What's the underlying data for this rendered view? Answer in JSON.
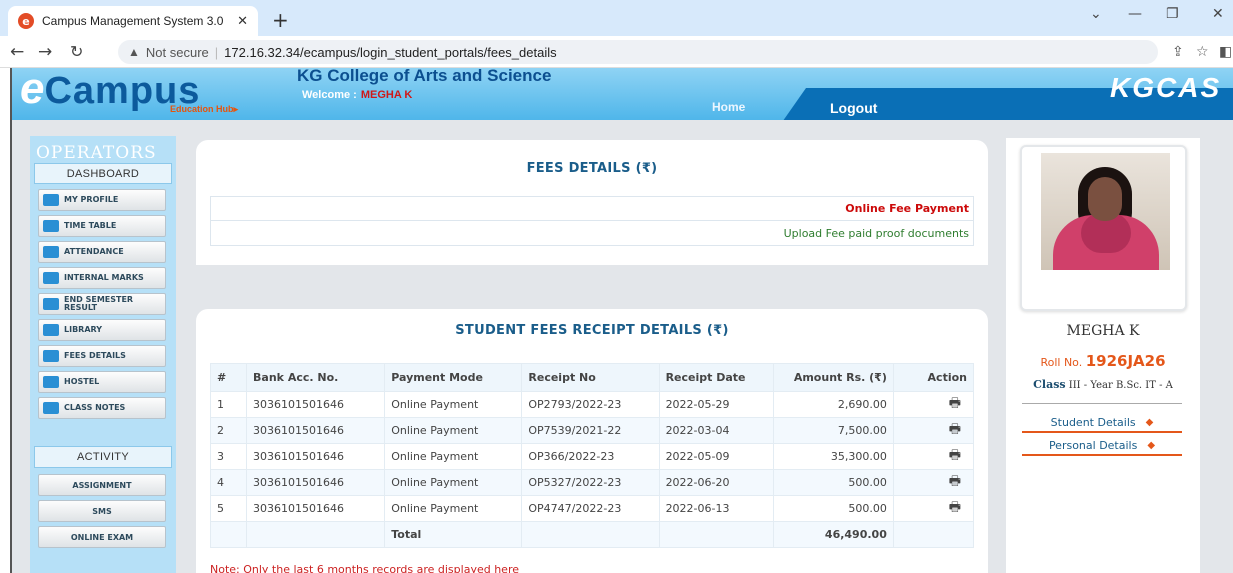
{
  "browser": {
    "tab_title": "Campus Management System 3.0",
    "not_secure": "Not secure",
    "url": "172.16.32.34/ecampus/login_student_portals/fees_details"
  },
  "header": {
    "logo_e": "e",
    "logo_text": "Campus",
    "logo_sub": "Education Hub▸",
    "college": "KG College of Arts and Science",
    "welcome_label": "Welcome :",
    "welcome_name": "MEGHA K",
    "nav_home": "Home",
    "nav_logout": "Logout",
    "brand": "KGCAS"
  },
  "sidebar": {
    "title": "OPERATORS",
    "dashboard": "DASHBOARD",
    "items": [
      {
        "label": "MY PROFILE",
        "icon": "building-icon"
      },
      {
        "label": "TIME TABLE",
        "icon": "clock-icon"
      },
      {
        "label": "ATTENDANCE",
        "icon": "calendar-icon"
      },
      {
        "label": "INTERNAL MARKS",
        "icon": "chart-icon"
      },
      {
        "label": "END SEMESTER RESULT",
        "icon": "trend-icon"
      },
      {
        "label": "LIBRARY",
        "icon": "books-icon"
      },
      {
        "label": "FEES DETAILS",
        "icon": "calendar-icon"
      },
      {
        "label": "HOSTEL",
        "icon": "building-icon"
      },
      {
        "label": "CLASS NOTES",
        "icon": "books-icon"
      }
    ],
    "activity_title": "ACTIVITY",
    "activity_items": [
      "ASSIGNMENT",
      "SMS",
      "ONLINE EXAM"
    ]
  },
  "fees_panel": {
    "title": "FEES DETAILS (₹)",
    "online_fee_payment": "Online Fee Payment",
    "upload_proof": "Upload Fee paid proof documents"
  },
  "receipts": {
    "title": "STUDENT FEES RECEIPT DETAILS (₹)",
    "columns": [
      "#",
      "Bank Acc. No.",
      "Payment Mode",
      "Receipt No",
      "Receipt Date",
      "Amount Rs. (₹)",
      "Action"
    ],
    "rows": [
      {
        "num": "1",
        "bank": "3036101501646",
        "mode": "Online Payment",
        "receipt": "OP2793/2022-23",
        "date": "2022-05-29",
        "amount": "2,690.00"
      },
      {
        "num": "2",
        "bank": "3036101501646",
        "mode": "Online Payment",
        "receipt": "OP7539/2021-22",
        "date": "2022-03-04",
        "amount": "7,500.00"
      },
      {
        "num": "3",
        "bank": "3036101501646",
        "mode": "Online Payment",
        "receipt": "OP366/2022-23",
        "date": "2022-05-09",
        "amount": "35,300.00"
      },
      {
        "num": "4",
        "bank": "3036101501646",
        "mode": "Online Payment",
        "receipt": "OP5327/2022-23",
        "date": "2022-06-20",
        "amount": "500.00"
      },
      {
        "num": "5",
        "bank": "3036101501646",
        "mode": "Online Payment",
        "receipt": "OP4747/2022-23",
        "date": "2022-06-13",
        "amount": "500.00"
      }
    ],
    "total_label": "Total",
    "total_amount": "46,490.00",
    "note": "Note: Only the last 6 months records are displayed here"
  },
  "profile": {
    "name": "MEGHA K",
    "roll_label": "Roll No.",
    "roll_no": "1926JA26",
    "class_label": "Class",
    "class_value": "III - Year B.Sc. IT - A",
    "student_details": "Student Details",
    "personal_details": "Personal Details"
  }
}
